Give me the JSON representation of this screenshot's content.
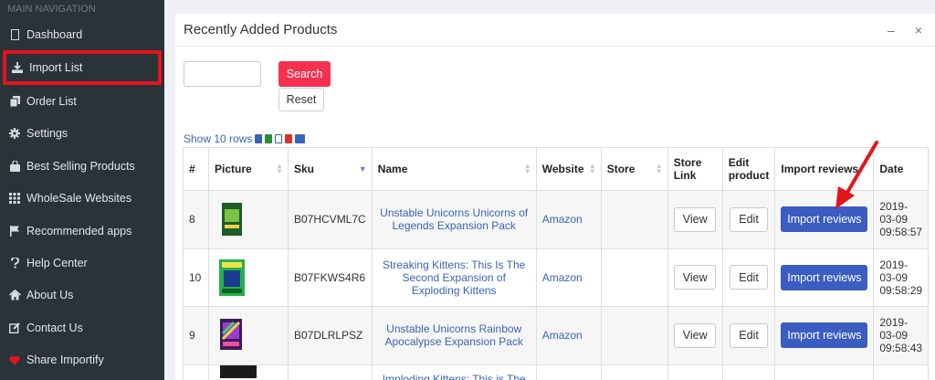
{
  "sidebar": {
    "header": "MAIN NAVIGATION",
    "items": [
      {
        "label": "Dashboard",
        "icon": "dashboard-icon"
      },
      {
        "label": "Import List",
        "icon": "download-icon"
      },
      {
        "label": "Order List",
        "icon": "copy-icon"
      },
      {
        "label": "Settings",
        "icon": "gear-icon"
      },
      {
        "label": "Best Selling Products",
        "icon": "shopping-bag-icon"
      },
      {
        "label": "WholeSale Websites",
        "icon": "grid-icon"
      },
      {
        "label": "Recommended apps",
        "icon": "flag-icon"
      },
      {
        "label": "Help Center",
        "icon": "question-icon"
      },
      {
        "label": "About Us",
        "icon": "home-icon"
      },
      {
        "label": "Contact Us",
        "icon": "edit-icon"
      },
      {
        "label": "Share Importify",
        "icon": "heart-icon"
      }
    ],
    "highlight_color": "#e4141d"
  },
  "panel": {
    "title": "Recently Added Products",
    "minimize": "–",
    "close": "×",
    "search_button": "Search",
    "reset_button": "Reset",
    "show_rows": "Show 10 rows"
  },
  "table": {
    "headers": [
      "#",
      "Picture",
      "Sku",
      "Name",
      "Website",
      "Store",
      "Store Link",
      "Edit product",
      "Import reviews",
      "Date"
    ],
    "rows": [
      {
        "num": "8",
        "sku": "B07HCVML7C",
        "name": "Unstable Unicorns Unicorns of Legends Expansion Pack",
        "website": "Amazon",
        "store": "",
        "view": "View",
        "edit": "Edit",
        "import": "Import reviews",
        "date": "2019-03-09 09:58:57",
        "thumb_color": "#1f5a2a"
      },
      {
        "num": "10",
        "sku": "B07FKWS4R6",
        "name": "Streaking Kittens: This Is The Second Expansion of Exploding Kittens",
        "website": "Amazon",
        "store": "",
        "view": "View",
        "edit": "Edit",
        "import": "Import reviews",
        "date": "2019-03-09 09:58:29",
        "thumb_color": "#27b04c"
      },
      {
        "num": "9",
        "sku": "B07DLRLPSZ",
        "name": "Unstable Unicorns Rainbow Apocalypse Expansion Pack",
        "website": "Amazon",
        "store": "",
        "view": "View",
        "edit": "Edit",
        "import": "Import reviews",
        "date": "2019-03-09 09:58:43",
        "thumb_color": "#5b2a8e"
      }
    ],
    "partial_row_name": "Imploding Kittens: This is The"
  },
  "colors": {
    "search": "#f4324f",
    "import": "#3b5cc0",
    "link": "#3a64b8",
    "arrow": "#e4141d"
  }
}
